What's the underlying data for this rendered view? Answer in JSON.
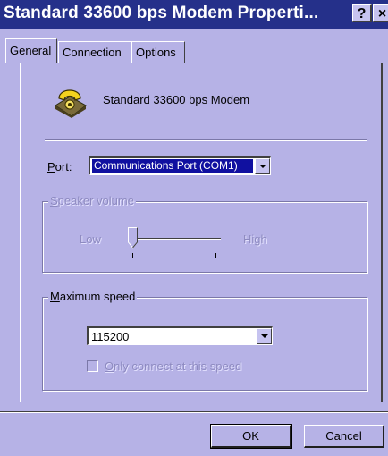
{
  "window": {
    "title": "Standard 33600 bps Modem Properti...",
    "help_label": "?",
    "close_label": "×"
  },
  "tabs": [
    {
      "label": "General",
      "active": true
    },
    {
      "label": "Connection",
      "active": false
    },
    {
      "label": "Options",
      "active": false
    }
  ],
  "general": {
    "modem_name": "Standard 33600 bps Modem",
    "port_label_u": "P",
    "port_label_rest": "ort:",
    "port_value": "Communications Port (COM1)",
    "speaker_volume_u": "S",
    "speaker_volume_rest": "peaker volume",
    "speaker_low": "Low",
    "speaker_high": "High",
    "max_speed_u": "M",
    "max_speed_rest": "aximum speed",
    "max_speed_value": "115200",
    "only_connect_u": "O",
    "only_connect_rest": "nly connect at this speed",
    "only_connect_checked": false
  },
  "buttons": {
    "ok": "OK",
    "cancel": "Cancel"
  },
  "colors": {
    "titlebar": "#25308a",
    "face": "#b6b2e6",
    "selection": "#1010a0",
    "disabled_text": "#8d8ac0"
  }
}
